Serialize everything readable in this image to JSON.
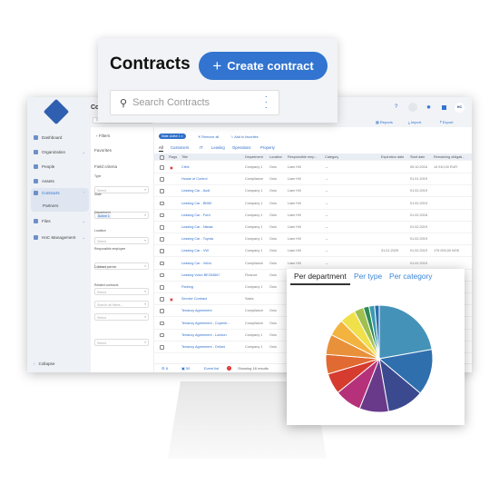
{
  "header": {
    "title": "Contracts",
    "create_label": "Create contract",
    "search_placeholder": "Search Contracts",
    "small_title": "Co",
    "small_search": "Search contracts",
    "avatar": "HC"
  },
  "toolbar": {
    "reports": "Reports",
    "import": "Import",
    "export": "Export"
  },
  "sidebar": {
    "items": [
      {
        "label": "Dashboard"
      },
      {
        "label": "Organization"
      },
      {
        "label": "People"
      },
      {
        "label": "Assets"
      },
      {
        "label": "Contracts"
      },
      {
        "label": "Partners"
      },
      {
        "label": "Files"
      },
      {
        "label": "HoC Management"
      }
    ],
    "collapse": "Collapse"
  },
  "filters": {
    "title": "Filters",
    "favorites": "Favorites",
    "field_criteria": "Field criteria",
    "fields": [
      {
        "label": "Type",
        "value": "Select"
      },
      {
        "label": "State",
        "value": "Active 1"
      },
      {
        "label": "Department",
        "value": "Select"
      },
      {
        "label": "Location",
        "value": "Select"
      },
      {
        "label": "Responsible employee",
        "value": "Select"
      },
      {
        "label": "Contract partner",
        "value": "Select"
      },
      {
        "label": "Related contracts",
        "value": "Select"
      }
    ],
    "search_all": "Search all filters..."
  },
  "chips": {
    "state": "State: Active 1",
    "remove_all": "Remove all",
    "add_fav": "Add to favorites"
  },
  "tabs": [
    "All",
    "Customers",
    "IT",
    "Leasing",
    "Operations",
    "Property"
  ],
  "table": {
    "columns": [
      "Flags",
      "Title",
      "Department",
      "Location",
      "Responsible emp...",
      "Category",
      "Expiration date",
      "Start date",
      "Remaining obligati..."
    ],
    "rows": [
      [
        "Citrix",
        "Company 1",
        "Oslo",
        "Liam Hill",
        "Leasing",
        "Software licenses",
        "",
        "05.10.2016",
        "14 910,00 EUR"
      ],
      [
        "House of Control",
        "Compliance",
        "Oslo",
        "Liam Hill",
        "Leasing",
        "Software licenses",
        "",
        "01.01.2019",
        ""
      ],
      [
        "Leasing Car - Audi",
        "Company 1",
        "Oslo",
        "Liam Hill",
        "Leasing",
        "Company cars",
        "",
        "01.02.2019",
        ""
      ],
      [
        "Leasing Car - BMW",
        "Company 1",
        "Oslo",
        "Liam Hill",
        "Leasing",
        "Company cars",
        "",
        "01.02.2019",
        ""
      ],
      [
        "Leasing Car - Ford",
        "Company 1",
        "Oslo",
        "Liam Hill",
        "Leasing",
        "Company cars",
        "",
        "01.02.2018",
        ""
      ],
      [
        "Leasing Car - Nissan",
        "Company 1",
        "Oslo",
        "Liam Hill",
        "Leasing",
        "Company cars",
        "",
        "01.02.2019",
        ""
      ],
      [
        "Leasing Car - Toyota",
        "Company 1",
        "Oslo",
        "Liam Hill",
        "Leasing",
        "Company cars",
        "",
        "01.02.2019",
        ""
      ],
      [
        "Leasing Car - VW",
        "Company 1",
        "Oslo",
        "Liam Hill",
        "Leasing",
        "Company cars",
        "31.01.2025",
        "01.02.2019",
        "175 000,00 NOK"
      ],
      [
        "Leasing Car - Volvo",
        "Compliance",
        "Oslo",
        "Liam Hill",
        "Leasing",
        "Company cars",
        "",
        "01.02.2019",
        ""
      ],
      [
        "Leasing Volvo BE334567",
        "Finance",
        "Oslo",
        "",
        "",
        "",
        "",
        "",
        ""
      ],
      [
        "Parking",
        "Company 1",
        "Oslo",
        "",
        "",
        "",
        "",
        "",
        ""
      ],
      [
        "Service Contract",
        "Sales",
        "",
        "",
        "",
        "",
        "",
        "",
        ""
      ],
      [
        "Tenancy Agreement",
        "Compliance",
        "Oslo",
        "",
        "",
        "",
        "",
        "",
        ""
      ],
      [
        "Tenancy Agreement - Copenh...",
        "Compliance",
        "Oslo",
        "",
        "",
        "",
        "",
        "",
        ""
      ],
      [
        "Tenancy Agreement - London",
        "Company 1",
        "Oslo",
        "",
        "",
        "",
        "",
        "",
        ""
      ],
      [
        "Tenancy Agreement - Oxford",
        "Company 1",
        "Oslo",
        "",
        "",
        "",
        "",
        "",
        ""
      ]
    ],
    "flagged": [
      0,
      11
    ]
  },
  "footer": {
    "count1": "8",
    "count2": "50",
    "event_list": "Event list",
    "event_badge": "!",
    "showing": "Showing 18 results"
  },
  "chart_tabs": [
    "Per department",
    "Per type",
    "Per category"
  ],
  "chart_data": {
    "type": "pie",
    "values": [
      22.2,
      13.9,
      11.1,
      8.8,
      8.1,
      6.3,
      5.9,
      6.1,
      5.1,
      4.8,
      2.9,
      1.7,
      1.7,
      1.4
    ],
    "colors": [
      "#4592b9",
      "#2f6fae",
      "#3b4a8f",
      "#6a3a8a",
      "#b5317a",
      "#d63b2f",
      "#e06a32",
      "#e8913a",
      "#f2b33f",
      "#f0e04a",
      "#9fbf50",
      "#2f8a55",
      "#3a9ab0",
      "#2a6cb0"
    ]
  },
  "colors": {
    "accent": "#3274d0"
  }
}
